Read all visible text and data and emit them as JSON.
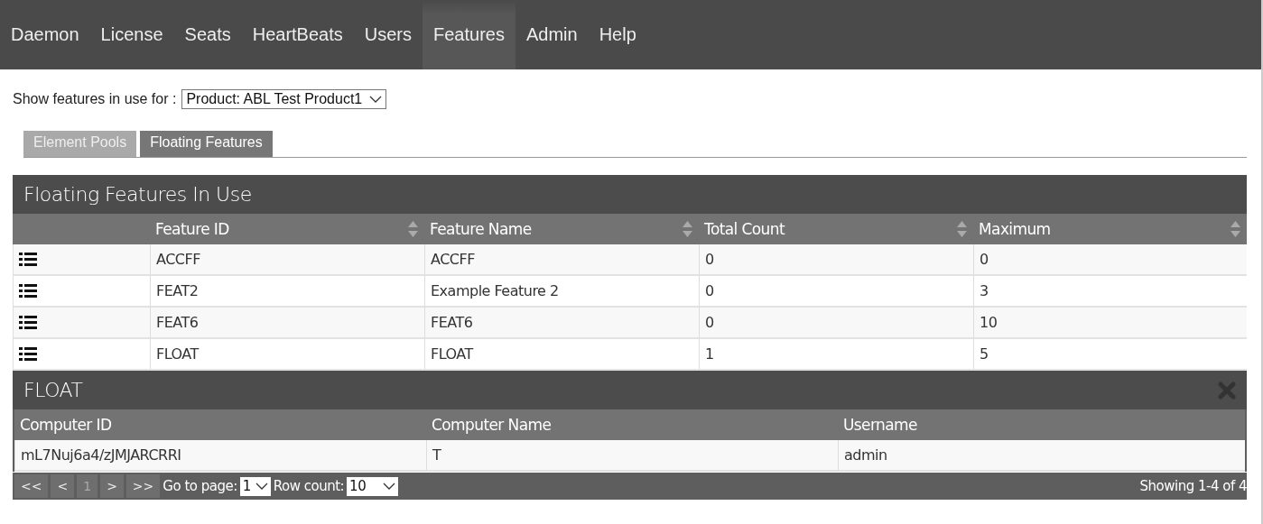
{
  "nav": [
    {
      "label": "Daemon",
      "selected": false
    },
    {
      "label": "License",
      "selected": false
    },
    {
      "label": "Seats",
      "selected": false
    },
    {
      "label": "HeartBeats",
      "selected": false
    },
    {
      "label": "Users",
      "selected": false
    },
    {
      "label": "Features",
      "selected": true
    },
    {
      "label": "Admin",
      "selected": false
    },
    {
      "label": "Help",
      "selected": false
    }
  ],
  "filter": {
    "label": "Show features in use for :",
    "value": "Product: ABL Test Product1"
  },
  "tabs": [
    {
      "label": "Element Pools",
      "selected": false
    },
    {
      "label": "Floating Features",
      "selected": true
    }
  ],
  "features_table": {
    "title": "Floating Features In Use",
    "columns": [
      "Feature ID",
      "Feature Name",
      "Total Count",
      "Maximum"
    ],
    "rows": [
      [
        "ACCFF",
        "ACCFF",
        "0",
        "0"
      ],
      [
        "FEAT2",
        "Example Feature 2",
        "0",
        "3"
      ],
      [
        "FEAT6",
        "FEAT6",
        "0",
        "10"
      ],
      [
        "FLOAT",
        "FLOAT",
        "1",
        "5"
      ]
    ]
  },
  "detail_table": {
    "title": "FLOAT",
    "columns": [
      "Computer ID",
      "Computer Name",
      "Username"
    ],
    "rows": [
      [
        "mL7Nuj6a4/zJMJARCRRI",
        "T",
        "admin"
      ]
    ]
  },
  "pager": {
    "buttons": [
      {
        "label": "<<",
        "selected": false
      },
      {
        "label": "<",
        "selected": false
      },
      {
        "label": "1",
        "selected": true
      },
      {
        "label": ">",
        "selected": false
      },
      {
        "label": ">>",
        "selected": false
      }
    ],
    "goto_label": "Go to page:",
    "goto_value": "1",
    "rowcount_label": "Row count:",
    "rowcount_value": "10",
    "status": "Showing 1-4 of 4"
  }
}
